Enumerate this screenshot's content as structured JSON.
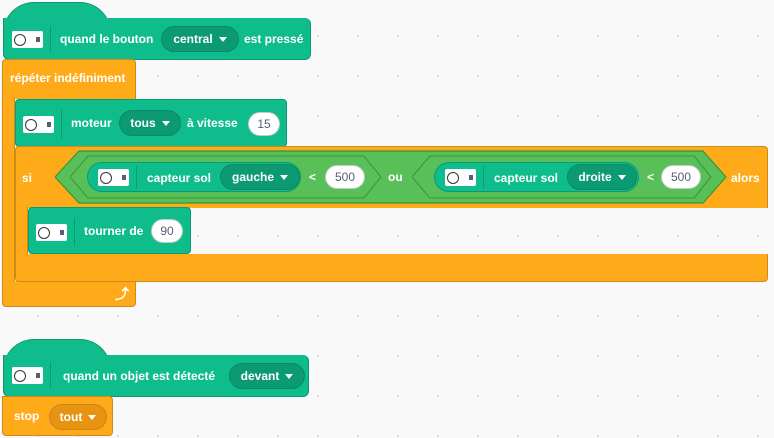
{
  "script1": {
    "hat": {
      "label_before": "quand le bouton",
      "port_value": "central",
      "label_after": "est pressé"
    },
    "loop": {
      "label": "répéter indéfiniment",
      "motor": {
        "label_before": "moteur",
        "motor_value": "tous",
        "label_after": "à vitesse",
        "speed_value": "15"
      },
      "if": {
        "label_if": "si",
        "label_then": "alors",
        "op_or": "ou",
        "left": {
          "label": "capteur sol",
          "side": "gauche",
          "op": "<",
          "value": "500"
        },
        "right": {
          "label": "capteur sol",
          "side": "droite",
          "op": "<",
          "value": "500"
        },
        "turn": {
          "label": "tourner de",
          "value": "90"
        }
      },
      "arrow_icon": "loop-arrow-icon"
    }
  },
  "script2": {
    "hat": {
      "label_before": "quand un objet est détecté",
      "direction_value": "devant"
    },
    "stop": {
      "label": "stop",
      "value": "tout"
    }
  },
  "colors": {
    "motion_green": "#0fbd8c",
    "operator_green": "#59c059",
    "control_orange": "#ffab19"
  },
  "icons": {
    "robot": "robot-motor-icon",
    "dropdown": "caret-down-icon"
  }
}
